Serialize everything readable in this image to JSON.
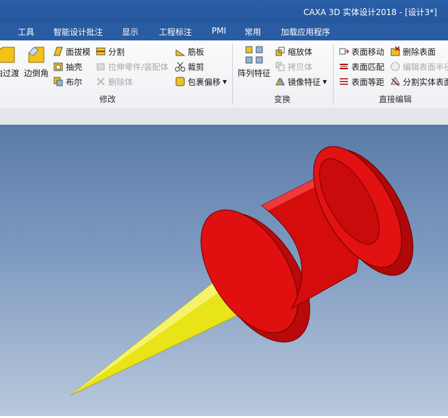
{
  "window": {
    "title": "CAXA 3D 实体设计2018 - [设计3*]"
  },
  "menu": [
    "工具",
    "智能设计批注",
    "显示",
    "工程标注",
    "PMI",
    "常用",
    "加载应用程序"
  ],
  "ribbon": {
    "modify": {
      "label": "修改",
      "big": [
        "曲过渡",
        "边倒角"
      ],
      "col1": [
        "面拔模",
        "抽壳",
        "布尔"
      ],
      "col2": [
        "分割",
        "拉伸零件/装配体",
        "删除体"
      ],
      "col3": [
        "筋板",
        "裁剪",
        "包裹偏移"
      ]
    },
    "transform": {
      "label": "变换",
      "big": "阵列特征",
      "items": [
        "缩放体",
        "拷贝体",
        "镜像特征"
      ]
    },
    "direct_edit": {
      "label": "直接编辑",
      "col1": [
        "表面移动",
        "表面匹配",
        "表面等距"
      ],
      "col2": [
        "删除表面",
        "编辑表面半径",
        "分割实体表面"
      ]
    }
  },
  "colors": {
    "part_body": "#cc0a0a",
    "cone": "#e6e21a",
    "title_bar": "#2b5fa8"
  }
}
